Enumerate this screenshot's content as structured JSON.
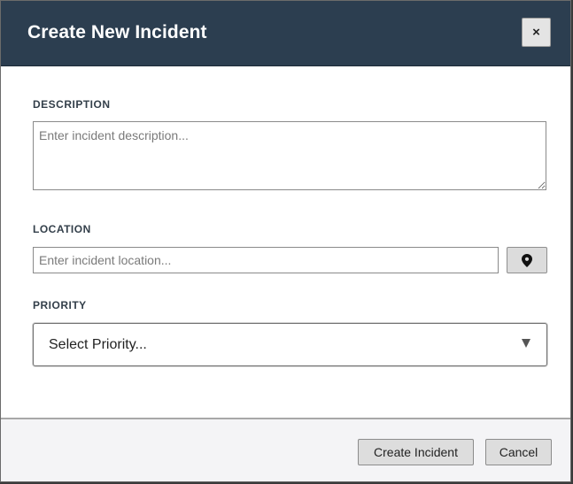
{
  "dialog": {
    "title": "Create New Incident",
    "close_label": "×"
  },
  "form": {
    "description": {
      "label": "DESCRIPTION",
      "value": "",
      "placeholder": "Enter incident description..."
    },
    "location": {
      "label": "LOCATION",
      "value": "",
      "placeholder": "Enter incident location...",
      "button_icon": "map-pin-icon"
    },
    "priority": {
      "label": "PRIORITY",
      "selected": "Select Priority...",
      "arrow_icon": "triangle-down-icon"
    }
  },
  "footer": {
    "create_label": "Create Incident",
    "cancel_label": "Cancel"
  },
  "colors": {
    "header_bg": "#2c3e50",
    "header_text": "#ffffff",
    "footer_bg": "#f4f4f6",
    "button_bg": "#dddddd"
  }
}
